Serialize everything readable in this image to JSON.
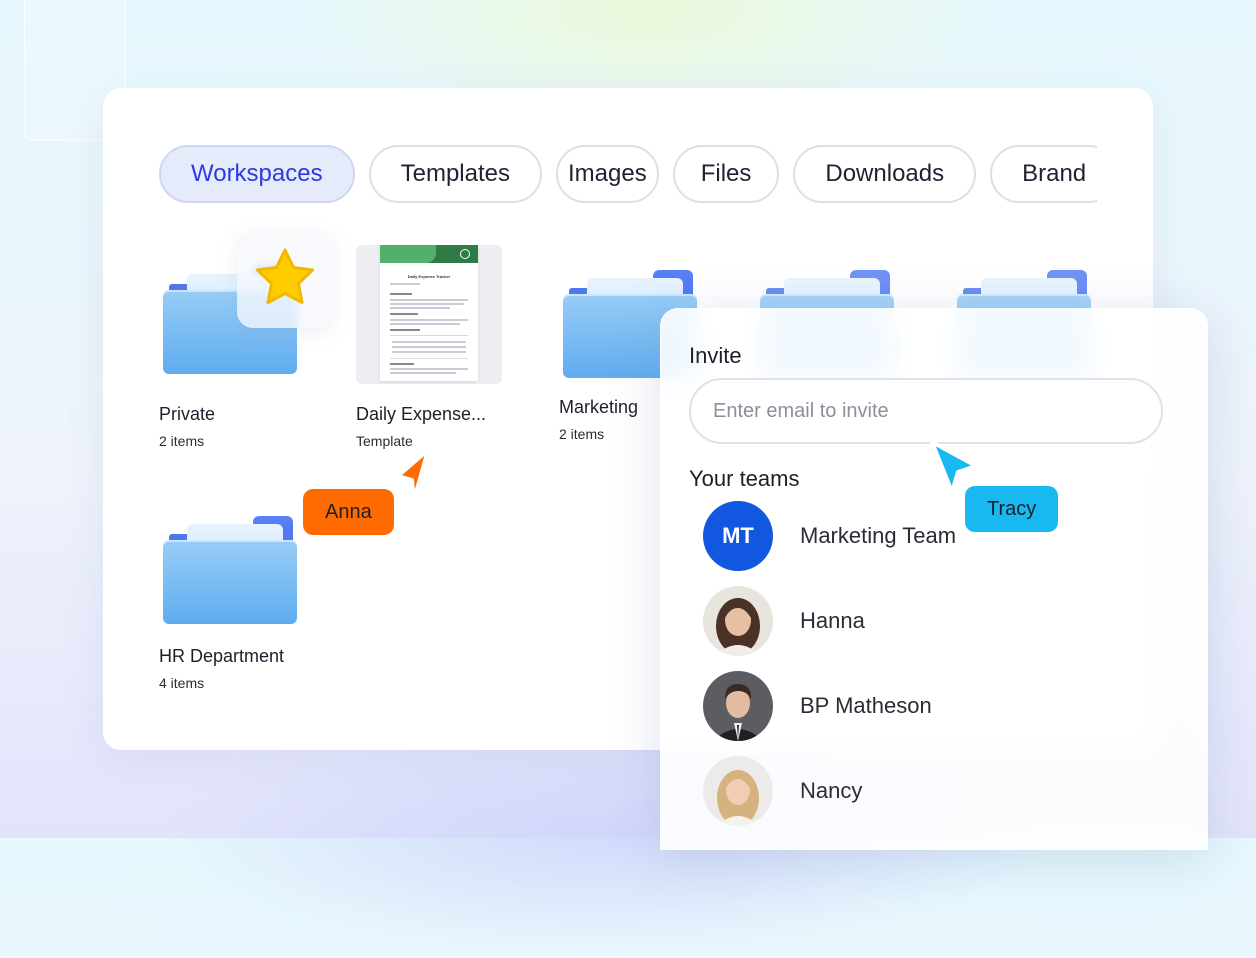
{
  "tabs": [
    {
      "label": "Workspaces",
      "active": true
    },
    {
      "label": "Templates",
      "active": false
    },
    {
      "label": "Images",
      "active": false
    },
    {
      "label": "Files",
      "active": false
    },
    {
      "label": "Downloads",
      "active": false
    },
    {
      "label": "Brand",
      "active": false
    }
  ],
  "items": {
    "private": {
      "title": "Private",
      "subtitle": "2 items",
      "starred": true
    },
    "daily_expense": {
      "title": "Daily Expense...",
      "subtitle": "Template",
      "thumbnail_title": "Daily Expense Tracker"
    },
    "marketing": {
      "title": "Marketing",
      "subtitle": "2 items"
    },
    "hr": {
      "title": "HR Department",
      "subtitle": "4 items"
    }
  },
  "invite": {
    "title": "Invite",
    "placeholder": "Enter email to invite",
    "teams_title": "Your teams",
    "teams": [
      {
        "initials": "MT",
        "name": "Marketing Team"
      },
      {
        "name": "Hanna"
      },
      {
        "name": "BP Matheson"
      },
      {
        "name": "Nancy"
      }
    ]
  },
  "cursors": [
    {
      "label": "Anna",
      "color": "#ff6b00"
    },
    {
      "label": "Tracy",
      "color": "#18b8f0"
    }
  ],
  "colors": {
    "accent": "#2b3be0",
    "avatar_team": "#1257e0",
    "folder_front": "#5eacef",
    "star": "#ffcc00"
  }
}
